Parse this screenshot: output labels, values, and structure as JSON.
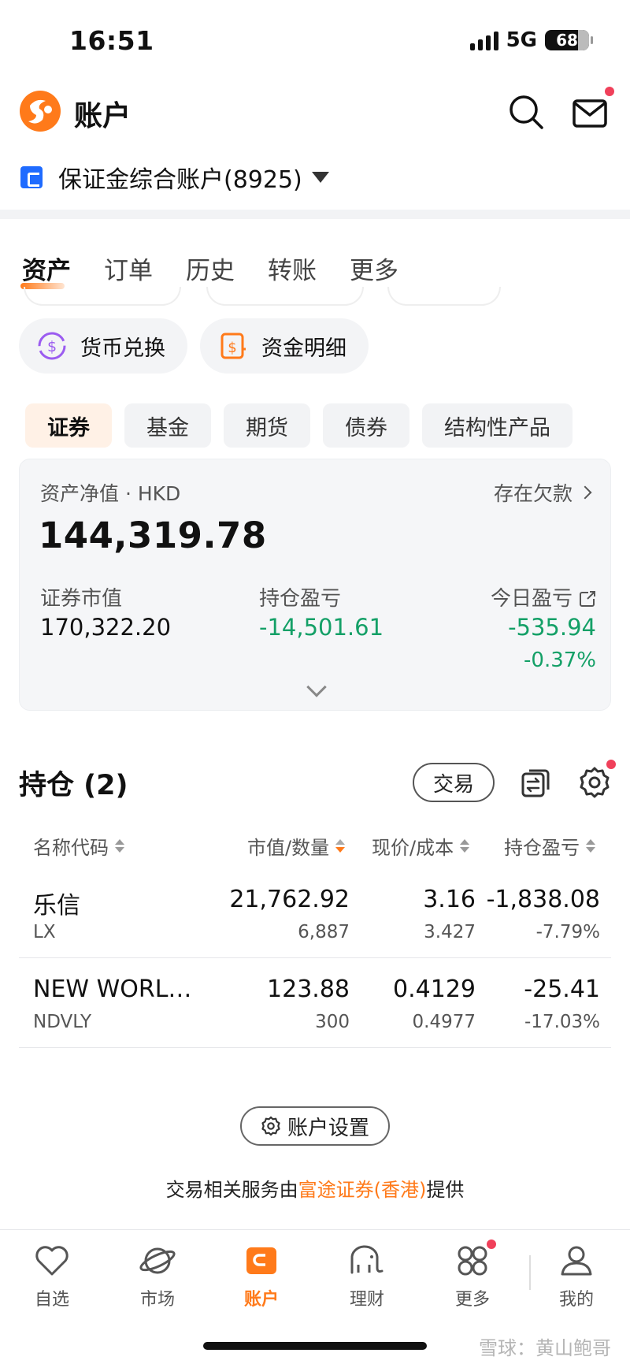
{
  "status_bar": {
    "time": "16:51",
    "network": "5G",
    "battery": "68"
  },
  "header": {
    "title": "账户"
  },
  "account": {
    "name": "保证金综合账户(8925)"
  },
  "tabs": [
    {
      "label": "资产",
      "active": true
    },
    {
      "label": "订单"
    },
    {
      "label": "历史"
    },
    {
      "label": "转账"
    },
    {
      "label": "更多"
    }
  ],
  "quick_actions": [
    {
      "label": "货币兑换",
      "icon": "currency-exchange-icon"
    },
    {
      "label": "资金明细",
      "icon": "fund-detail-icon"
    }
  ],
  "asset_categories": [
    {
      "label": "证券",
      "active": true
    },
    {
      "label": "基金"
    },
    {
      "label": "期货"
    },
    {
      "label": "债券"
    },
    {
      "label": "结构性产品"
    }
  ],
  "asset_summary": {
    "net_asset_label": "资产净值 · HKD",
    "net_asset_value": "144,319.78",
    "debt_link": "存在欠款",
    "market_value_label": "证券市值",
    "market_value": "170,322.20",
    "position_pnl_label": "持仓盈亏",
    "position_pnl": "-14,501.61",
    "today_pnl_label": "今日盈亏",
    "today_pnl": "-535.94",
    "today_pnl_pct": "-0.37%"
  },
  "holdings": {
    "title": "持仓 (2)",
    "trade_label": "交易",
    "columns": [
      "名称代码",
      "市值/数量",
      "现价/成本",
      "持仓盈亏"
    ],
    "rows": [
      {
        "name": "乐信",
        "code": "LX",
        "market_value": "21,762.92",
        "quantity": "6,887",
        "price": "3.16",
        "cost": "3.427",
        "pnl": "-1,838.08",
        "pnl_pct": "-7.79%"
      },
      {
        "name": "NEW WORL…",
        "code": "NDVLY",
        "market_value": "123.88",
        "quantity": "300",
        "price": "0.4129",
        "cost": "0.4977",
        "pnl": "-25.41",
        "pnl_pct": "-17.03%"
      }
    ]
  },
  "footer": {
    "settings_label": "账户设置",
    "provider_prefix": "交易相关服务由",
    "provider_link": "富途证券(香港)",
    "provider_suffix": "提供"
  },
  "bottom_nav": [
    {
      "label": "自选",
      "icon": "heart-icon"
    },
    {
      "label": "市场",
      "icon": "planet-icon"
    },
    {
      "label": "账户",
      "icon": "wallet-icon",
      "active": true
    },
    {
      "label": "理财",
      "icon": "elephant-icon"
    },
    {
      "label": "更多",
      "icon": "grid-icon"
    },
    {
      "label": "我的",
      "icon": "user-icon"
    }
  ],
  "watermark": "雪球：黄山鲍哥",
  "colors": {
    "accent": "#ff7a1a",
    "loss_green": "#14a067",
    "notification_red": "#f0405a",
    "account_blue": "#1f6bff"
  }
}
